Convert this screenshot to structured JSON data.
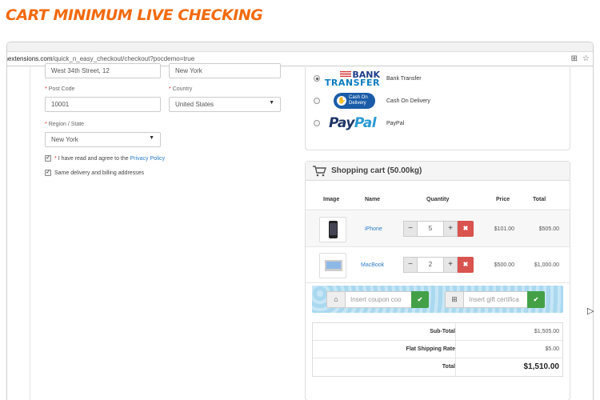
{
  "banner": {
    "title": "CART MINIMUM LIVE CHECKING"
  },
  "browser": {
    "url_host": "anextensions.com",
    "url_path": "/quick_n_easy_checkout/checkout?pocdemo=true",
    "icons": [
      "translate-icon",
      "star-icon"
    ]
  },
  "form": {
    "address_value": "West 34th Street, 12",
    "city_value": "New York",
    "postcode_label": "Post Code",
    "postcode_value": "10001",
    "country_label": "Country",
    "country_value": "United States",
    "region_label": "Region / State",
    "region_value": "New York",
    "required_mark": "*",
    "privacy_text": "I have read and agree to the",
    "privacy_link": "Privacy Policy",
    "same_address_text": "Same delivery and billing addresses"
  },
  "payment": {
    "selected": "bank_transfer",
    "methods": [
      {
        "id": "bank_transfer",
        "label": "Bank Transfer",
        "logo_line1": "BANK",
        "logo_line2": "TRANSFER"
      },
      {
        "id": "cod",
        "label": "Cash On Delivery",
        "logo_line1": "Cash On",
        "logo_line2": "Delivery"
      },
      {
        "id": "paypal",
        "label": "PayPal",
        "logo_part1": "Pay",
        "logo_part2": "Pal"
      }
    ]
  },
  "cart": {
    "title": "Shopping cart (50.00kg)",
    "columns": {
      "image": "Image",
      "name": "Name",
      "quantity": "Quantity",
      "price": "Price",
      "total": "Total"
    },
    "items": [
      {
        "name": "iPhone",
        "quantity": "5",
        "price": "$101.00",
        "total": "$505.00"
      },
      {
        "name": "MacBook",
        "quantity": "2",
        "price": "$500.00",
        "total": "$1,000.00"
      }
    ],
    "minus_label": "−",
    "plus_label": "+",
    "remove_label": "✖",
    "coupon_placeholder": "Insert coupon coo",
    "gift_placeholder": "Insert gift certifica",
    "apply_label": "✔",
    "totals": [
      {
        "label": "Sub-Total",
        "value": "$1,505.00"
      },
      {
        "label": "Flat Shipping Rate",
        "value": "$5.00"
      },
      {
        "label": "Total",
        "value": "$1,510.00"
      }
    ]
  },
  "colors": {
    "banner": "#f26a0f",
    "link": "#2a7cc7",
    "remove": "#d9534f",
    "apply": "#43a047"
  }
}
